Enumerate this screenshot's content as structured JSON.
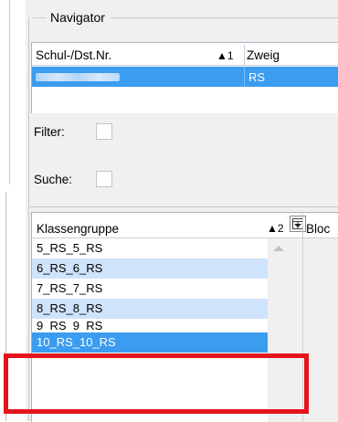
{
  "navigator": {
    "title": "Navigator",
    "grid1": {
      "col1_header": "Schul-/Dst.Nr.",
      "col1_sort": "▲1",
      "col2_header": "Zweig",
      "selected_row_zweig": "RS"
    },
    "filter_label": "Filter:",
    "suche_label": "Suche:",
    "grid2": {
      "col1_header": "Klassengruppe",
      "col1_sort": "▲2",
      "col2_header": "Bloc",
      "rows": [
        "5_RS_5_RS",
        "6_RS_6_RS",
        "7_RS_7_RS",
        "8_RS_8_RS",
        "9_RS_9_RS",
        "10_RS_10_RS"
      ],
      "selected_row": "10_RS_10_RS"
    }
  },
  "colors": {
    "selection": "#3b9cf0",
    "alt_row": "#cfe3fb",
    "highlight_box": "#e4141b"
  },
  "icons": {
    "grid2_column_chooser": "column-chooser-icon",
    "sort_ascending": "sort-ascending-icon",
    "scroll_up": "scroll-up-arrow-icon"
  }
}
